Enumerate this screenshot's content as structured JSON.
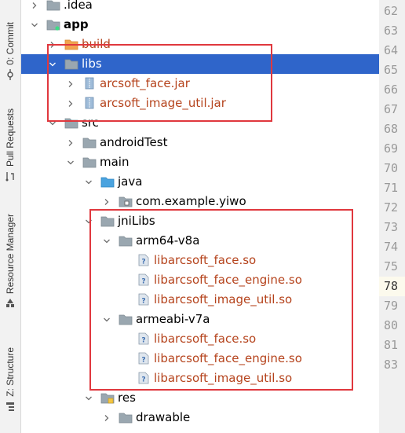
{
  "side_tabs": [
    {
      "label": "0: Commit",
      "icon": "commit-icon"
    },
    {
      "label": "Pull Requests",
      "icon": "pull-requests-icon"
    },
    {
      "label": "Resource Manager",
      "icon": "resource-manager-icon"
    },
    {
      "label": "Z: Structure",
      "icon": "structure-icon"
    }
  ],
  "tree_rows": [
    {
      "label": ".idea",
      "depth": 0,
      "expander": "collapsed",
      "icon": "folder",
      "style": "normal"
    },
    {
      "label": "app",
      "depth": 0,
      "expander": "expanded",
      "icon": "module-folder",
      "style": "bold"
    },
    {
      "label": "build",
      "depth": 1,
      "expander": "collapsed",
      "icon": "folder-orange",
      "style": "excluded"
    },
    {
      "label": "libs",
      "depth": 1,
      "expander": "expanded",
      "icon": "folder",
      "style": "selected"
    },
    {
      "label": "arcsoft_face.jar",
      "depth": 2,
      "expander": "collapsed",
      "icon": "jar",
      "style": "red"
    },
    {
      "label": "arcsoft_image_util.jar",
      "depth": 2,
      "expander": "collapsed",
      "icon": "jar",
      "style": "red"
    },
    {
      "label": "src",
      "depth": 1,
      "expander": "expanded",
      "icon": "folder",
      "style": "normal"
    },
    {
      "label": "androidTest",
      "depth": 2,
      "expander": "collapsed",
      "icon": "folder",
      "style": "normal"
    },
    {
      "label": "main",
      "depth": 2,
      "expander": "expanded",
      "icon": "folder",
      "style": "normal"
    },
    {
      "label": "java",
      "depth": 3,
      "expander": "expanded",
      "icon": "folder-blue",
      "style": "normal"
    },
    {
      "label": "com.example.yiwo",
      "depth": 4,
      "expander": "collapsed",
      "icon": "package",
      "style": "normal"
    },
    {
      "label": "jniLibs",
      "depth": 3,
      "expander": "expanded",
      "icon": "folder",
      "style": "normal"
    },
    {
      "label": "arm64-v8a",
      "depth": 4,
      "expander": "expanded",
      "icon": "folder",
      "style": "normal"
    },
    {
      "label": "libarcsoft_face.so",
      "depth": 5,
      "expander": "none",
      "icon": "unknown-file",
      "style": "red"
    },
    {
      "label": "libarcsoft_face_engine.so",
      "depth": 5,
      "expander": "none",
      "icon": "unknown-file",
      "style": "red"
    },
    {
      "label": "libarcsoft_image_util.so",
      "depth": 5,
      "expander": "none",
      "icon": "unknown-file",
      "style": "red"
    },
    {
      "label": "armeabi-v7a",
      "depth": 4,
      "expander": "expanded",
      "icon": "folder",
      "style": "normal"
    },
    {
      "label": "libarcsoft_face.so",
      "depth": 5,
      "expander": "none",
      "icon": "unknown-file",
      "style": "red"
    },
    {
      "label": "libarcsoft_face_engine.so",
      "depth": 5,
      "expander": "none",
      "icon": "unknown-file",
      "style": "red"
    },
    {
      "label": "libarcsoft_image_util.so",
      "depth": 5,
      "expander": "none",
      "icon": "unknown-file",
      "style": "red"
    },
    {
      "label": "res",
      "depth": 3,
      "expander": "expanded",
      "icon": "folder-res",
      "style": "normal"
    },
    {
      "label": "drawable",
      "depth": 4,
      "expander": "collapsed",
      "icon": "folder",
      "style": "normal"
    }
  ],
  "line_numbers": [
    "62",
    "63",
    "64",
    "65",
    "66",
    "67",
    "68",
    "69",
    "70",
    "71",
    "72",
    "73",
    "74",
    "75",
    "78",
    "79",
    "80",
    "81",
    "83"
  ],
  "current_line": "78",
  "highlight_color": "#e0383e",
  "selection_color": "#2f65ca"
}
